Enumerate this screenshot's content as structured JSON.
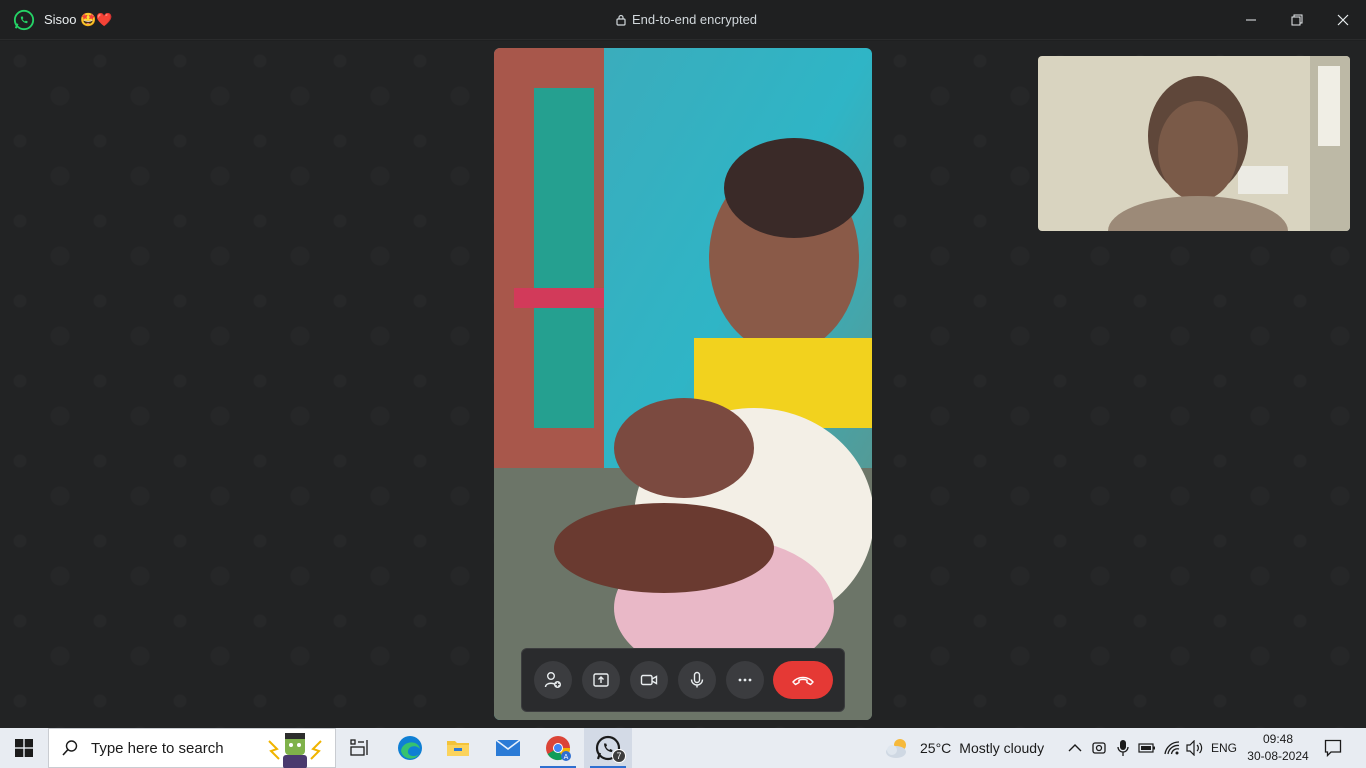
{
  "titlebar": {
    "contact_name": "Sisoo 🤩❤️",
    "encryption_label": "End-to-end encrypted"
  },
  "call": {
    "controls": [
      "add-participant",
      "share-screen",
      "video",
      "microphone",
      "more",
      "end-call"
    ]
  },
  "taskbar": {
    "search_placeholder": "Type here to search",
    "weather_temp": "25°C",
    "weather_desc": "Mostly cloudy",
    "language": "ENG",
    "time": "09:48",
    "date": "30-08-2024",
    "whatsapp_badge": "7"
  },
  "colors": {
    "end_call": "#e53935",
    "whatsapp_green": "#25d366",
    "background": "#1f2021"
  }
}
